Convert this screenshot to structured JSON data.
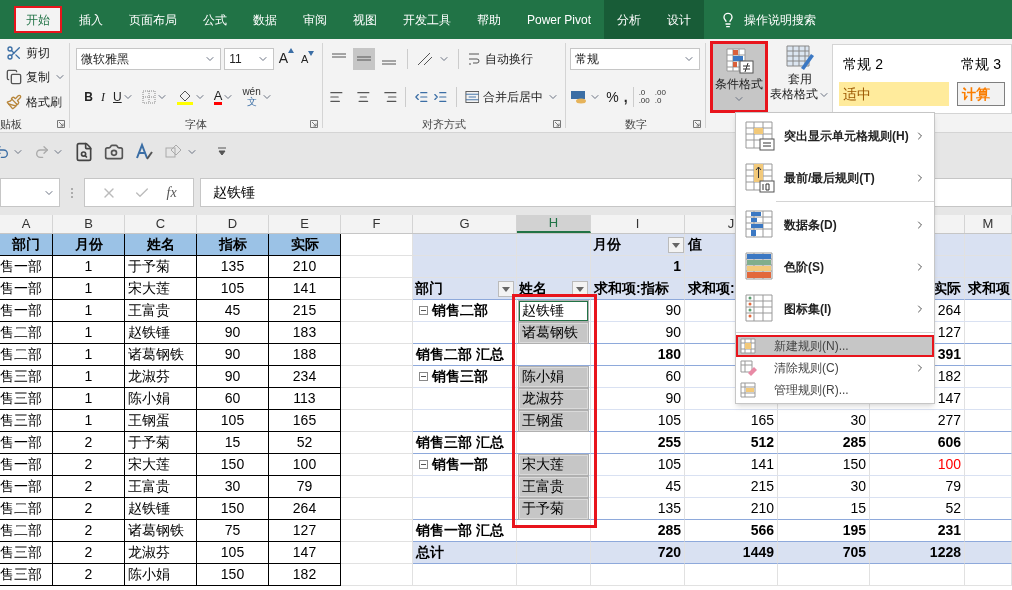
{
  "ribbon_tabs": [
    {
      "label": "开始",
      "selected": true,
      "kind": "main"
    },
    {
      "label": "插入",
      "selected": false,
      "kind": "main"
    },
    {
      "label": "页面布局",
      "selected": false,
      "kind": "main"
    },
    {
      "label": "公式",
      "selected": false,
      "kind": "main"
    },
    {
      "label": "数据",
      "selected": false,
      "kind": "main"
    },
    {
      "label": "审阅",
      "selected": false,
      "kind": "main"
    },
    {
      "label": "视图",
      "selected": false,
      "kind": "main"
    },
    {
      "label": "开发工具",
      "selected": false,
      "kind": "main"
    },
    {
      "label": "帮助",
      "selected": false,
      "kind": "main"
    },
    {
      "label": "Power Pivot",
      "selected": false,
      "kind": "main"
    },
    {
      "label": "分析",
      "selected": false,
      "kind": "contextual"
    },
    {
      "label": "设计",
      "selected": false,
      "kind": "contextual"
    }
  ],
  "tell_me": "操作说明搜索",
  "clipboard": {
    "cut": "剪切",
    "copy": "复制",
    "painter": "格式刷",
    "label": "贴板"
  },
  "font_group": {
    "font": "微软雅黑",
    "size": "11",
    "grow": "A",
    "shrink": "A",
    "bold": "B",
    "italic": "I",
    "underline": "U",
    "font_color": "A",
    "phonetic_top": "wén",
    "phonetic_bottom": "文",
    "label": "字体"
  },
  "align_group": {
    "wrap": "自动换行",
    "merge": "合并后居中",
    "label": "对齐方式"
  },
  "number_group": {
    "format": "常规",
    "percent": "%",
    "comma": ",",
    "decimals": [
      {
        "top": ".0",
        "bottom": ".00"
      },
      {
        "top": ".00",
        "bottom": ".0"
      }
    ],
    "label": "数字"
  },
  "styles_group": {
    "conditional": "条件格式",
    "conditional_pressed": true,
    "table_top": "套用",
    "table_bottom": "表格格式",
    "gallery": [
      {
        "label": "常规 2",
        "kind": "normal"
      },
      {
        "label": "常规 3",
        "kind": "normal"
      },
      {
        "label": "适中",
        "kind": "neutral"
      },
      {
        "label": "计算",
        "kind": "calculation"
      }
    ]
  },
  "formula_bar": {
    "fx": "fx",
    "value": "赵铁锤"
  },
  "column_headers": [
    {
      "label": "A",
      "selected": false
    },
    {
      "label": "B",
      "selected": false
    },
    {
      "label": "C",
      "selected": false
    },
    {
      "label": "D",
      "selected": false
    },
    {
      "label": "E",
      "selected": false
    },
    {
      "label": "F",
      "selected": false
    },
    {
      "label": "G",
      "selected": false
    },
    {
      "label": "H",
      "selected": true
    },
    {
      "label": "I",
      "selected": false
    },
    {
      "label": "J",
      "selected": false
    },
    {
      "label": "M",
      "selected": false
    }
  ],
  "sheet_table": {
    "header": [
      "部门",
      "月份",
      "姓名",
      "指标",
      "实际"
    ],
    "rows": [
      [
        "售一部",
        "1",
        "于予菊",
        "135",
        "210"
      ],
      [
        "售一部",
        "1",
        "宋大莲",
        "105",
        "141"
      ],
      [
        "售一部",
        "1",
        "王富贵",
        "45",
        "215"
      ],
      [
        "售二部",
        "1",
        "赵铁锤",
        "90",
        "183"
      ],
      [
        "售二部",
        "1",
        "诸葛钢铁",
        "90",
        "188"
      ],
      [
        "售三部",
        "1",
        "龙淑芬",
        "90",
        "234"
      ],
      [
        "售三部",
        "1",
        "陈小娟",
        "60",
        "113"
      ],
      [
        "售三部",
        "1",
        "王钢蛋",
        "105",
        "165"
      ],
      [
        "售一部",
        "2",
        "于予菊",
        "15",
        "52"
      ],
      [
        "售一部",
        "2",
        "宋大莲",
        "150",
        "100"
      ],
      [
        "售一部",
        "2",
        "王富贵",
        "30",
        "79"
      ],
      [
        "售二部",
        "2",
        "赵铁锤",
        "150",
        "264"
      ],
      [
        "售二部",
        "2",
        "诸葛钢铁",
        "75",
        "127"
      ],
      [
        "售三部",
        "2",
        "龙淑芬",
        "105",
        "147"
      ],
      [
        "售三部",
        "2",
        "陈小娟",
        "150",
        "182"
      ]
    ]
  },
  "pivot": {
    "rows": [
      {
        "kind": "caption",
        "i": "月份",
        "j": "值"
      },
      {
        "kind": "month",
        "i": "1"
      },
      {
        "kind": "header",
        "g": "部门",
        "h": "姓名",
        "i": "求和项:指标",
        "j": "求和项:",
        "l": "实际",
        "m": "求和项"
      },
      {
        "kind": "item",
        "g": "销售二部",
        "expanded": true,
        "h": "赵铁锤",
        "selected": true,
        "active": true,
        "i": "90",
        "l": "264",
        "flagged": false
      },
      {
        "kind": "item",
        "h": "诸葛钢铁",
        "selected": true,
        "active": false,
        "i": "90",
        "l": "127",
        "flagged": false
      },
      {
        "kind": "subtotal",
        "g": "销售二部 汇总",
        "i": "180",
        "l": "391"
      },
      {
        "kind": "item",
        "g": "销售三部",
        "expanded": true,
        "h": "陈小娟",
        "selected": true,
        "active": false,
        "i": "60",
        "l": "182",
        "flagged": false
      },
      {
        "kind": "item",
        "h": "龙淑芬",
        "selected": true,
        "active": false,
        "i": "90",
        "l": "147",
        "flagged": false
      },
      {
        "kind": "item",
        "h": "王钢蛋",
        "selected": true,
        "active": false,
        "i": "105",
        "j": "165",
        "k": "30",
        "l": "277",
        "flagged": false
      },
      {
        "kind": "subtotal",
        "g": "销售三部 汇总",
        "i": "255",
        "j": "512",
        "k": "285",
        "l": "606"
      },
      {
        "kind": "item",
        "g": "销售一部",
        "expanded": true,
        "h": "宋大莲",
        "selected": true,
        "active": false,
        "i": "105",
        "j": "141",
        "k": "150",
        "l": "100",
        "flagged": true
      },
      {
        "kind": "item",
        "h": "王富贵",
        "selected": true,
        "active": false,
        "i": "45",
        "j": "215",
        "k": "30",
        "l": "79",
        "flagged": false
      },
      {
        "kind": "item",
        "h": "于予菊",
        "selected": true,
        "active": false,
        "i": "135",
        "j": "210",
        "k": "15",
        "l": "52",
        "flagged": false
      },
      {
        "kind": "subtotal",
        "g": "销售一部 汇总",
        "i": "285",
        "j": "566",
        "k": "195",
        "l": "231"
      },
      {
        "kind": "grand",
        "g": "总计",
        "i": "720",
        "j": "1449",
        "k": "705",
        "l": "1228"
      }
    ]
  },
  "cf_menu": {
    "items": [
      {
        "label": "突出显示单元格规则(H)",
        "kind": "highlight",
        "submenu": true,
        "selected": false
      },
      {
        "label": "最前/最后规则(T)",
        "kind": "topbottom",
        "submenu": true,
        "selected": false
      },
      {
        "label": "数据条(D)",
        "kind": "databar",
        "submenu": true,
        "selected": false
      },
      {
        "label": "色阶(S)",
        "kind": "colorscale",
        "submenu": true,
        "selected": false
      },
      {
        "label": "图标集(I)",
        "kind": "iconset",
        "submenu": true,
        "selected": false
      },
      {
        "label": "新建规则(N)...",
        "kind": "newrule",
        "submenu": false,
        "selected": true
      },
      {
        "label": "清除规则(C)",
        "kind": "clear",
        "submenu": true,
        "selected": false
      },
      {
        "label": "管理规则(R)...",
        "kind": "manage",
        "submenu": false,
        "selected": false
      }
    ]
  }
}
